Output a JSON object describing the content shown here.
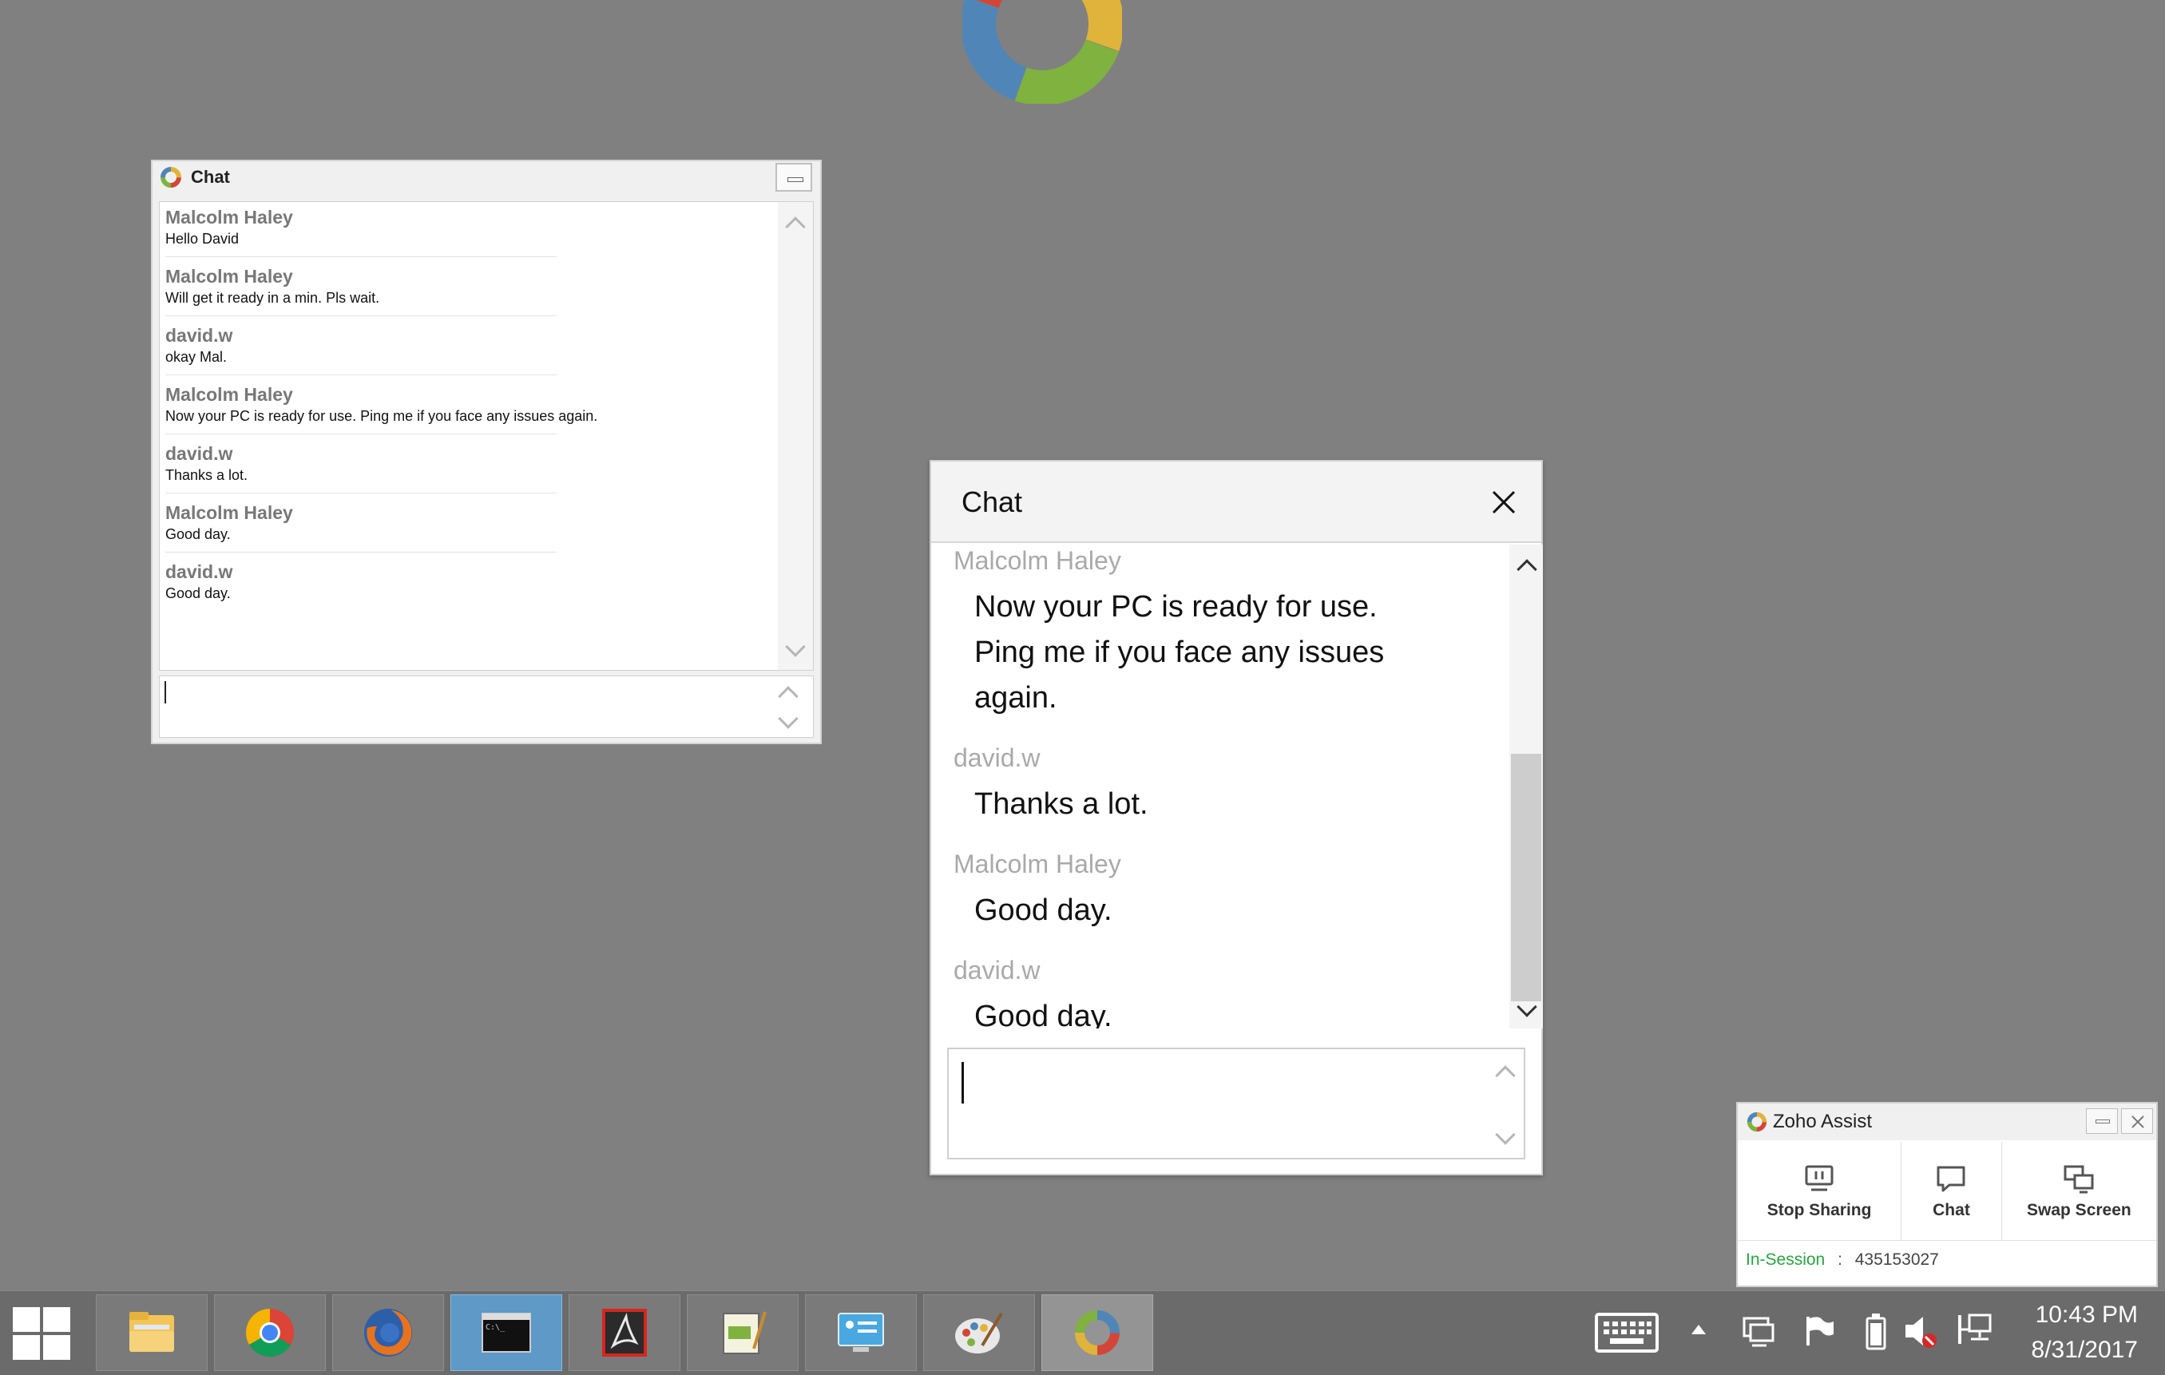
{
  "small_chat": {
    "title": "Chat",
    "messages": [
      {
        "sender": "Malcolm Haley",
        "text": "Hello David"
      },
      {
        "sender": "Malcolm Haley",
        "text": "Will get it ready in a min. Pls wait."
      },
      {
        "sender": "david.w",
        "text": "okay Mal."
      },
      {
        "sender": "Malcolm Haley",
        "text": "Now your PC is ready for use. Ping me if you face any issues again."
      },
      {
        "sender": "david.w",
        "text": "Thanks a lot."
      },
      {
        "sender": "Malcolm Haley",
        "text": "Good day."
      },
      {
        "sender": "david.w",
        "text": "Good day."
      }
    ],
    "input_value": ""
  },
  "big_chat": {
    "title": "Chat",
    "messages": [
      {
        "sender": "Malcolm Haley",
        "lines": [
          "Now your PC is ready for use.",
          "Ping me if you face any issues",
          "again."
        ]
      },
      {
        "sender": "david.w",
        "lines": [
          "Thanks a lot."
        ]
      },
      {
        "sender": "Malcolm Haley",
        "lines": [
          "Good day."
        ]
      },
      {
        "sender": "david.w",
        "lines": [
          "Good day."
        ]
      }
    ],
    "input_value": ""
  },
  "zoho": {
    "title": "Zoho Assist",
    "stop_sharing": "Stop Sharing",
    "chat": "Chat",
    "swap_screen": "Swap Screen",
    "status_label": "In-Session",
    "status_sep": ":",
    "session_id": "435153027",
    "status_color": "#2aa441"
  },
  "taskbar": {
    "apps": [
      "file-explorer-icon",
      "chrome-icon",
      "firefox-icon",
      "command-prompt-icon",
      "acrobat-icon",
      "notepad-icon",
      "control-panel-icon",
      "paint-icon",
      "zoho-assist-icon"
    ],
    "time": "10:43 PM",
    "date": "8/31/2017"
  }
}
